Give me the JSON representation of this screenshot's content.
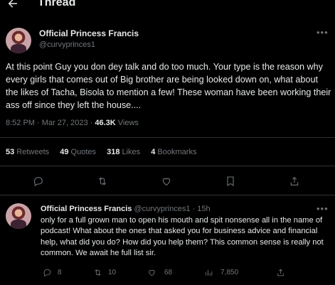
{
  "header": {
    "title": "Thread"
  },
  "tweet": {
    "author_name": "Official Princess Francis",
    "author_handle": "@curvyprinces1",
    "text": "At this point Guy you don dey talk and do too much. Your type is the reason why every girls that comes out of Big brother are being looked down on, what about the likes of Tacha, Bisola to mention a few! These woman have been working their ass off since they left the house....",
    "time": "8:52 PM · Mar 27, 2023 · ",
    "views_count": "46.3K",
    "views_label": " Views",
    "stats": {
      "retweets_count": "53",
      "retweets_label": " Retweets",
      "quotes_count": "49",
      "quotes_label": " Quotes",
      "likes_count": "318",
      "likes_label": " Likes",
      "bookmarks_count": "4",
      "bookmarks_label": " Bookmarks"
    }
  },
  "reply": {
    "author_name": "Official Princess Francis",
    "author_handle": "@curvyprinces1 · 15h",
    "text": "only for a full grown man to open his mouth and spit nonsense all in the name of podcast! What about the ones that asked you for  business advice and financial help, what did you do? How did you help them? This common sense is really not common. We await he full list sir.",
    "replies": "8",
    "retweets": "10",
    "likes": "68",
    "views": "7,850"
  },
  "icons": {
    "back": "arrow-left-icon",
    "more": "more-horizontal-icon",
    "reply": "comment-icon",
    "retweet": "retweet-icon",
    "like": "heart-icon",
    "bookmark": "bookmark-icon",
    "share": "share-icon",
    "views": "analytics-icon"
  },
  "colors": {
    "background": "#000000",
    "text": "#e7e9ea",
    "secondary": "#71767b",
    "divider": "#2f3336"
  }
}
